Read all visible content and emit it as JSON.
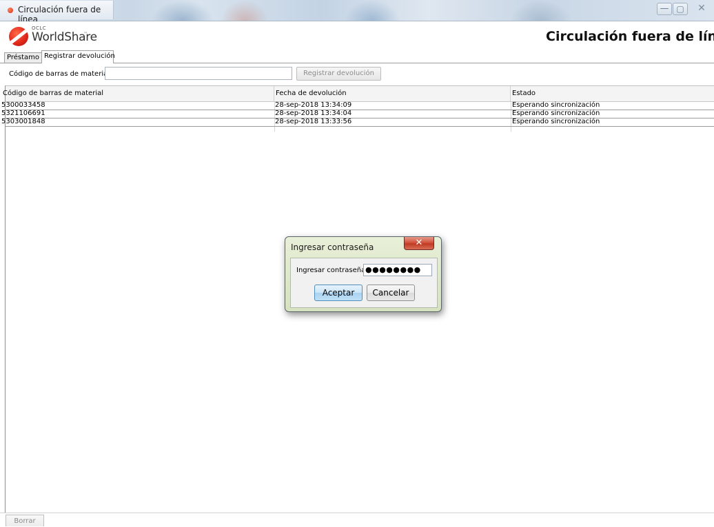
{
  "window": {
    "title": "Circulación fuera de línea",
    "minimize_glyph": "—",
    "maximize_glyph": "▢",
    "close_glyph": "✕"
  },
  "header": {
    "logo_small": "OCLC",
    "logo_text": "WorldShare",
    "logo_tm": "™",
    "app_title": "Circulación fuera de línea"
  },
  "tabs": [
    {
      "label": "Préstamo",
      "active": false
    },
    {
      "label": "Registrar devolución",
      "active": true
    }
  ],
  "barcode": {
    "label": "Código de barras de material",
    "value": "",
    "button_label": "Registrar devolución",
    "button_enabled": false
  },
  "table": {
    "headers": [
      "Código de barras de material",
      "Fecha de devolución",
      "Estado"
    ],
    "rows": [
      [
        "5300033458",
        "28-sep-2018 13:34:09",
        "Esperando sincronización"
      ],
      [
        "5321106691",
        "28-sep-2018 13:34:04",
        "Esperando sincronización"
      ],
      [
        "5303001848",
        "28-sep-2018 13:33:56",
        "Esperando sincronización"
      ]
    ]
  },
  "footer": {
    "clear_label": "Borrar",
    "clear_enabled": false
  },
  "dialog": {
    "title": "Ingresar contraseña",
    "close_glyph": "✕",
    "password_label": "Ingresar contraseña",
    "password_masked": "●●●●●●●●",
    "ok_label": "Aceptar",
    "cancel_label": "Cancelar"
  },
  "colors": {
    "dialog_frame": "#dfe9cc",
    "dialog_close": "#c13a24",
    "ok_button": "#bfe0f6",
    "logo_red": "#e2281b"
  }
}
